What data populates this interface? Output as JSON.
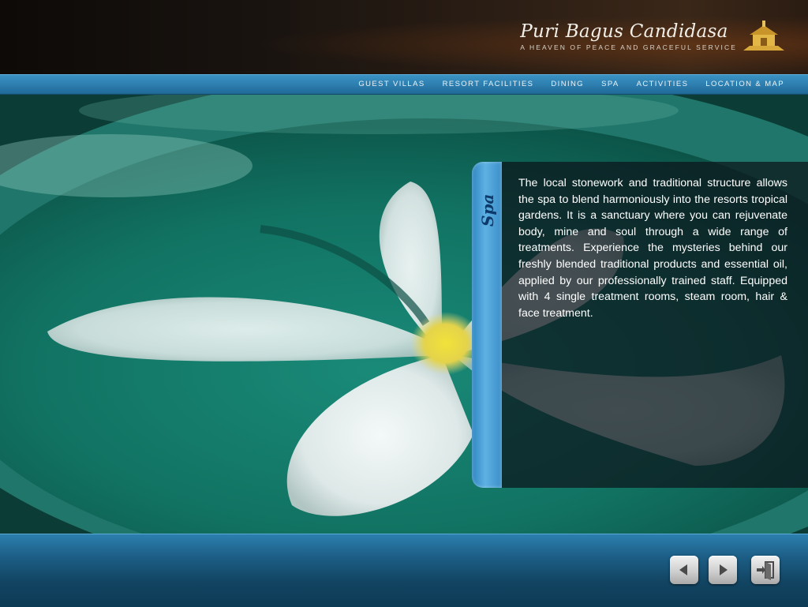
{
  "header": {
    "brand_title": "Puri Bagus Candidasa",
    "brand_tagline": "A HEAVEN OF PEACE AND GRACEFUL SERVICE"
  },
  "nav": {
    "items": [
      {
        "label": "GUEST VILLAS"
      },
      {
        "label": "RESORT  FACILITIES"
      },
      {
        "label": "DINING"
      },
      {
        "label": "SPA"
      },
      {
        "label": "ACTIVITIES"
      },
      {
        "label": "LOCATION  &  MAP"
      }
    ]
  },
  "panel": {
    "title": "Spa",
    "body": "The local stonework and traditional structure allows the spa to blend harmoniously into the resorts tropical gardens.  It is a sanctuary where you can rejuvenate body, mine and soul through a wide range of treatments.  Experience the mysteries behind our freshly blended traditional products and essential oil, applied by our professionally trained staff.  Equipped with 4 single treatment rooms, steam room, hair & face treatment."
  },
  "controls": {
    "prev_icon": "triangle-left-icon",
    "next_icon": "triangle-right-icon",
    "exit_icon": "exit-door-icon"
  },
  "colors": {
    "nav_bar": "#2e7fb0",
    "panel_tab": "#5eb1e3",
    "footer": "#1d5f87",
    "bowl_green": "#137060"
  }
}
